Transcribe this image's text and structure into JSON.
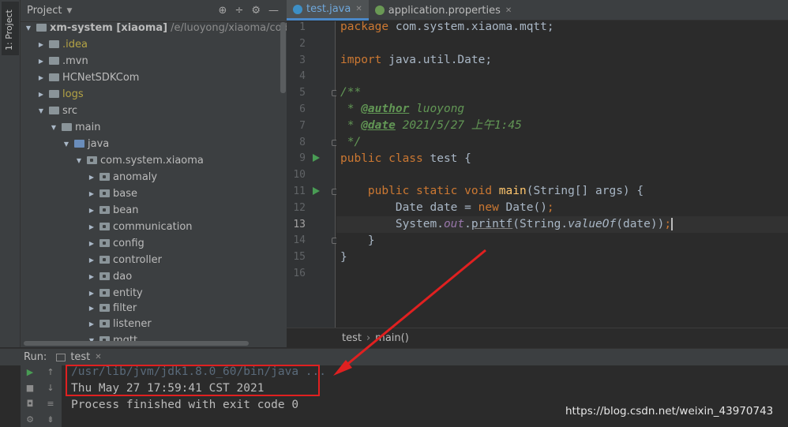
{
  "toolstrip": {
    "project_tab": "1: Project"
  },
  "project": {
    "title": "Project",
    "items": [
      {
        "label": "xm-system [xiaoma]",
        "path": "/e/luoyong/xiaoma/code/x"
      },
      {
        "label": ".idea"
      },
      {
        "label": ".mvn"
      },
      {
        "label": "HCNetSDKCom"
      },
      {
        "label": "logs"
      },
      {
        "label": "src"
      },
      {
        "label": "main"
      },
      {
        "label": "java"
      },
      {
        "label": "com.system.xiaoma"
      },
      {
        "label": "anomaly"
      },
      {
        "label": "base"
      },
      {
        "label": "bean"
      },
      {
        "label": "communication"
      },
      {
        "label": "config"
      },
      {
        "label": "controller"
      },
      {
        "label": "dao"
      },
      {
        "label": "entity"
      },
      {
        "label": "filter"
      },
      {
        "label": "listener"
      },
      {
        "label": "mqtt"
      }
    ]
  },
  "tabs": [
    {
      "label": "test.java",
      "active": true
    },
    {
      "label": "application.properties",
      "active": false
    }
  ],
  "editor": {
    "line_numbers": [
      "1",
      "2",
      "3",
      "4",
      "5",
      "6",
      "7",
      "8",
      "9",
      "10",
      "11",
      "12",
      "13",
      "14",
      "15",
      "16"
    ],
    "current_line": "13",
    "code": {
      "l1_kw": "package",
      "l1_rest": " com.system.xiaoma.mqtt;",
      "l3_kw": "import",
      "l3_rest": " java.util.Date;",
      "l5": "/**",
      "l6_pre": " * ",
      "l6_tag": "@author",
      "l6_val": " luoyong",
      "l7_pre": " * ",
      "l7_tag": "@date",
      "l7_val": " 2021/5/27 上午1:45",
      "l8": " */",
      "l9_kw": "public class",
      "l9_rest": " test {",
      "l11_indent": "    ",
      "l11_kw": "public static void",
      "l11_sp": " ",
      "l11_fn": "main",
      "l11_rest": "(String[] args) {",
      "l12_a": "        Date date = ",
      "l12_kw": "new",
      "l12_b": " Date()",
      "l12_c": ";",
      "l13_a": "        System.",
      "l13_out": "out",
      "l13_dot": ".",
      "l13_printf": "printf",
      "l13_b": "(String.",
      "l13_valueof": "valueOf",
      "l13_c": "(date))",
      "l13_d": ";",
      "l14": "    }",
      "l15": "}"
    }
  },
  "breadcrumb": {
    "class_name": "test",
    "separator": "›",
    "method": "main()"
  },
  "run": {
    "label": "Run:",
    "tab": "test",
    "console": [
      "/usr/lib/jvm/jdk1.8.0_60/bin/java ...",
      "Thu May 27 17:59:41 CST 2021",
      "Process finished with exit code 0"
    ]
  },
  "watermark": "https://blog.csdn.net/weixin_43970743",
  "colors": {
    "keyword": "#cc7832",
    "comment": "#629755",
    "function": "#ffc66d",
    "static_field": "#9876aa",
    "annotation_red": "#e02020",
    "tab_active": "#4a88c7"
  }
}
